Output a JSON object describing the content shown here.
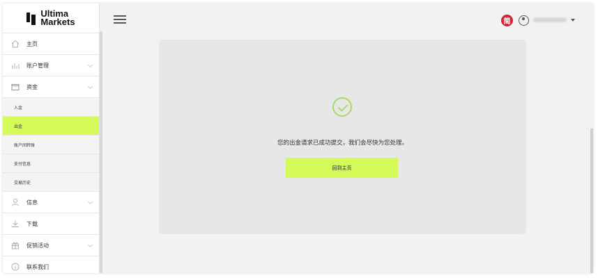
{
  "logo": {
    "line1": "Ultima",
    "line2": "Markets"
  },
  "sidebar": {
    "items": [
      {
        "label": "主页",
        "icon": "home-icon"
      },
      {
        "label": "账户管理",
        "icon": "bar-chart-icon"
      },
      {
        "label": "资金",
        "icon": "wallet-icon"
      }
    ],
    "sub_items": [
      {
        "label": "入金"
      },
      {
        "label": "出金",
        "active": true
      },
      {
        "label": "账户间转账"
      },
      {
        "label": "支付信息"
      },
      {
        "label": "交易历史"
      }
    ],
    "items_after": [
      {
        "label": "信息",
        "icon": "user-icon"
      },
      {
        "label": "下载",
        "icon": "download-icon"
      },
      {
        "label": "促销活动",
        "icon": "gift-icon"
      },
      {
        "label": "联系我们",
        "icon": "info-icon"
      }
    ]
  },
  "header": {
    "language_badge": "简"
  },
  "main": {
    "message": "您的出金请求已成功提交，我们会尽快为您处理。",
    "home_button_label": "回到主页"
  },
  "colors": {
    "accent": "#d4fa5a",
    "success": "#a9d86a",
    "language_badge": "#d4243c"
  }
}
